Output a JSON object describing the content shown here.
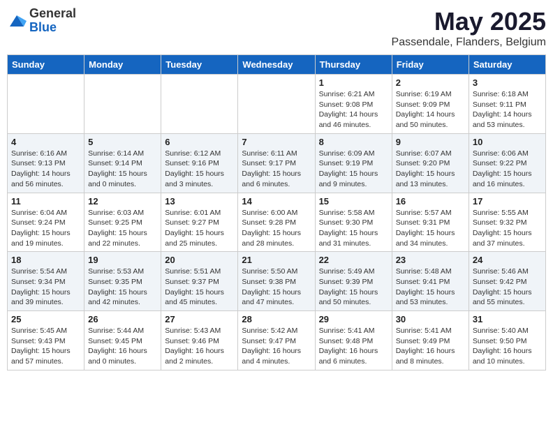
{
  "header": {
    "logo_general": "General",
    "logo_blue": "Blue",
    "title": "May 2025",
    "subtitle": "Passendale, Flanders, Belgium"
  },
  "weekdays": [
    "Sunday",
    "Monday",
    "Tuesday",
    "Wednesday",
    "Thursday",
    "Friday",
    "Saturday"
  ],
  "weeks": [
    [
      {
        "day": "",
        "info": ""
      },
      {
        "day": "",
        "info": ""
      },
      {
        "day": "",
        "info": ""
      },
      {
        "day": "",
        "info": ""
      },
      {
        "day": "1",
        "info": "Sunrise: 6:21 AM\nSunset: 9:08 PM\nDaylight: 14 hours\nand 46 minutes."
      },
      {
        "day": "2",
        "info": "Sunrise: 6:19 AM\nSunset: 9:09 PM\nDaylight: 14 hours\nand 50 minutes."
      },
      {
        "day": "3",
        "info": "Sunrise: 6:18 AM\nSunset: 9:11 PM\nDaylight: 14 hours\nand 53 minutes."
      }
    ],
    [
      {
        "day": "4",
        "info": "Sunrise: 6:16 AM\nSunset: 9:13 PM\nDaylight: 14 hours\nand 56 minutes."
      },
      {
        "day": "5",
        "info": "Sunrise: 6:14 AM\nSunset: 9:14 PM\nDaylight: 15 hours\nand 0 minutes."
      },
      {
        "day": "6",
        "info": "Sunrise: 6:12 AM\nSunset: 9:16 PM\nDaylight: 15 hours\nand 3 minutes."
      },
      {
        "day": "7",
        "info": "Sunrise: 6:11 AM\nSunset: 9:17 PM\nDaylight: 15 hours\nand 6 minutes."
      },
      {
        "day": "8",
        "info": "Sunrise: 6:09 AM\nSunset: 9:19 PM\nDaylight: 15 hours\nand 9 minutes."
      },
      {
        "day": "9",
        "info": "Sunrise: 6:07 AM\nSunset: 9:20 PM\nDaylight: 15 hours\nand 13 minutes."
      },
      {
        "day": "10",
        "info": "Sunrise: 6:06 AM\nSunset: 9:22 PM\nDaylight: 15 hours\nand 16 minutes."
      }
    ],
    [
      {
        "day": "11",
        "info": "Sunrise: 6:04 AM\nSunset: 9:24 PM\nDaylight: 15 hours\nand 19 minutes."
      },
      {
        "day": "12",
        "info": "Sunrise: 6:03 AM\nSunset: 9:25 PM\nDaylight: 15 hours\nand 22 minutes."
      },
      {
        "day": "13",
        "info": "Sunrise: 6:01 AM\nSunset: 9:27 PM\nDaylight: 15 hours\nand 25 minutes."
      },
      {
        "day": "14",
        "info": "Sunrise: 6:00 AM\nSunset: 9:28 PM\nDaylight: 15 hours\nand 28 minutes."
      },
      {
        "day": "15",
        "info": "Sunrise: 5:58 AM\nSunset: 9:30 PM\nDaylight: 15 hours\nand 31 minutes."
      },
      {
        "day": "16",
        "info": "Sunrise: 5:57 AM\nSunset: 9:31 PM\nDaylight: 15 hours\nand 34 minutes."
      },
      {
        "day": "17",
        "info": "Sunrise: 5:55 AM\nSunset: 9:32 PM\nDaylight: 15 hours\nand 37 minutes."
      }
    ],
    [
      {
        "day": "18",
        "info": "Sunrise: 5:54 AM\nSunset: 9:34 PM\nDaylight: 15 hours\nand 39 minutes."
      },
      {
        "day": "19",
        "info": "Sunrise: 5:53 AM\nSunset: 9:35 PM\nDaylight: 15 hours\nand 42 minutes."
      },
      {
        "day": "20",
        "info": "Sunrise: 5:51 AM\nSunset: 9:37 PM\nDaylight: 15 hours\nand 45 minutes."
      },
      {
        "day": "21",
        "info": "Sunrise: 5:50 AM\nSunset: 9:38 PM\nDaylight: 15 hours\nand 47 minutes."
      },
      {
        "day": "22",
        "info": "Sunrise: 5:49 AM\nSunset: 9:39 PM\nDaylight: 15 hours\nand 50 minutes."
      },
      {
        "day": "23",
        "info": "Sunrise: 5:48 AM\nSunset: 9:41 PM\nDaylight: 15 hours\nand 53 minutes."
      },
      {
        "day": "24",
        "info": "Sunrise: 5:46 AM\nSunset: 9:42 PM\nDaylight: 15 hours\nand 55 minutes."
      }
    ],
    [
      {
        "day": "25",
        "info": "Sunrise: 5:45 AM\nSunset: 9:43 PM\nDaylight: 15 hours\nand 57 minutes."
      },
      {
        "day": "26",
        "info": "Sunrise: 5:44 AM\nSunset: 9:45 PM\nDaylight: 16 hours\nand 0 minutes."
      },
      {
        "day": "27",
        "info": "Sunrise: 5:43 AM\nSunset: 9:46 PM\nDaylight: 16 hours\nand 2 minutes."
      },
      {
        "day": "28",
        "info": "Sunrise: 5:42 AM\nSunset: 9:47 PM\nDaylight: 16 hours\nand 4 minutes."
      },
      {
        "day": "29",
        "info": "Sunrise: 5:41 AM\nSunset: 9:48 PM\nDaylight: 16 hours\nand 6 minutes."
      },
      {
        "day": "30",
        "info": "Sunrise: 5:41 AM\nSunset: 9:49 PM\nDaylight: 16 hours\nand 8 minutes."
      },
      {
        "day": "31",
        "info": "Sunrise: 5:40 AM\nSunset: 9:50 PM\nDaylight: 16 hours\nand 10 minutes."
      }
    ]
  ]
}
